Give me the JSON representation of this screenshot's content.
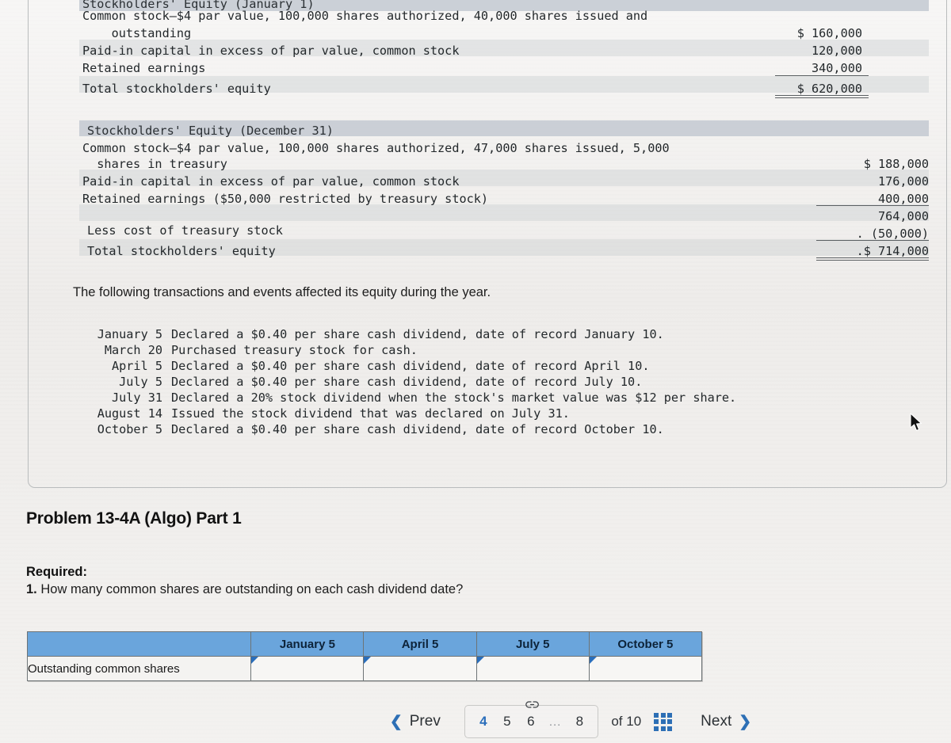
{
  "statements": [
    {
      "id": "january",
      "header": "Stockholders' Equity (January 1)",
      "lines": [
        {
          "text": "Common stock—$4 par value, 100,000 shares authorized, 40,000 shares issued and",
          "amount": ""
        },
        {
          "text": "    outstanding",
          "amount": "$ 160,000"
        },
        {
          "text": "Paid-in capital in excess of par value, common stock",
          "amount": "120,000"
        },
        {
          "text": "Retained earnings",
          "amount": "340,000"
        },
        {
          "text": "Total stockholders' equity",
          "amount": "$ 620,000"
        }
      ]
    },
    {
      "id": "december",
      "header": "Stockholders' Equity (December 31)",
      "lines": [
        {
          "text": "Common stock—$4 par value, 100,000 shares authorized, 47,000 shares issued, 5,000",
          "amount": ""
        },
        {
          "text": "  shares in treasury",
          "amount": "$ 188,000"
        },
        {
          "text": "Paid-in capital in excess of par value, common stock",
          "amount": "176,000"
        },
        {
          "text": "Retained earnings ($50,000 restricted by treasury stock)",
          "amount": "400,000"
        },
        {
          "text": "",
          "amount": "764,000"
        },
        {
          "text": "Less cost of treasury stock",
          "amount": ". (50,000)"
        },
        {
          "text": "Total stockholders' equity",
          "amount": ".$ 714,000"
        }
      ]
    }
  ],
  "intro": "The following transactions and events affected its equity during the year.",
  "transactions": [
    {
      "date": "January 5",
      "desc": "Declared a $0.40 per share cash dividend, date of record January 10."
    },
    {
      "date": "March 20",
      "desc": "Purchased treasury stock for cash."
    },
    {
      "date": "April 5",
      "desc": "Declared a $0.40 per share cash dividend, date of record April 10."
    },
    {
      "date": "July 5",
      "desc": "Declared a $0.40 per share cash dividend, date of record July 10."
    },
    {
      "date": "July 31",
      "desc": "Declared a 20% stock dividend when the stock's market value was $12 per share."
    },
    {
      "date": "August 14",
      "desc": "Issued the stock dividend that was declared on July 31."
    },
    {
      "date": "October 5",
      "desc": "Declared a $0.40 per share cash dividend, date of record October 10."
    }
  ],
  "problem": {
    "title": "Problem 13-4A (Algo) Part 1",
    "required_label": "Required:",
    "required_number": "1.",
    "required_text": "How many common shares are outstanding on each cash dividend date?"
  },
  "answer_table": {
    "corner_label": "",
    "columns": [
      "January 5",
      "April 5",
      "July 5",
      "October 5"
    ],
    "rows": [
      {
        "label": "Outstanding common shares",
        "values": [
          "",
          "",
          "",
          ""
        ]
      }
    ]
  },
  "nav": {
    "prev_label": "Prev",
    "prev_icon": "chevron-left-icon",
    "next_label": "Next",
    "next_icon": "chevron-right-icon",
    "pages": [
      "4",
      "5",
      "6",
      "...",
      "8"
    ],
    "active_page": "4",
    "link_icon": "link-chain-icon",
    "of_text": "of 10",
    "grid_icon": "grid-3x3-icon"
  },
  "colors": {
    "header_band": "#c3c9d1",
    "table_header": "#6aa5dc",
    "accent_blue": "#2a6ebb",
    "page_background": "#eeecea"
  }
}
